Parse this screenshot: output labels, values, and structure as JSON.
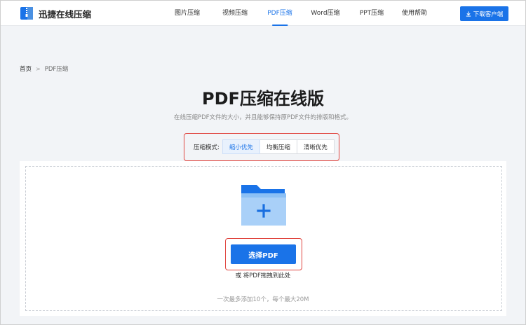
{
  "brand": {
    "name": "迅捷在线压缩",
    "logo_icon": "zip-file-logo-icon",
    "accent_color": "#1a73e8"
  },
  "nav": {
    "items": [
      {
        "label": "图片压缩",
        "active": false
      },
      {
        "label": "视频压缩",
        "active": false
      },
      {
        "label": "PDF压缩",
        "active": true
      },
      {
        "label": "Word压缩",
        "active": false
      },
      {
        "label": "PPT压缩",
        "active": false
      },
      {
        "label": "使用帮助",
        "active": false
      }
    ],
    "download_label": "下载客户端",
    "download_icon": "download-icon"
  },
  "breadcrumb": {
    "home": "首页",
    "separator": ">",
    "current": "PDF压缩"
  },
  "page": {
    "title": "PDF压缩在线版",
    "subtitle": "在线压缩PDF文件的大小，并且能够保持原PDF文件的排版和格式。"
  },
  "mode": {
    "label": "压缩模式:",
    "options": [
      "缩小优先",
      "均衡压缩",
      "清晰优先"
    ],
    "selected": "缩小优先"
  },
  "upload": {
    "folder_icon": "folder-plus-icon",
    "button_label": "选择PDF",
    "drag_hint": "或 将PDF拖拽到此处",
    "limit_hint": "一次最多添加10个，每个最大20M"
  },
  "highlight_color": "#e0453f"
}
